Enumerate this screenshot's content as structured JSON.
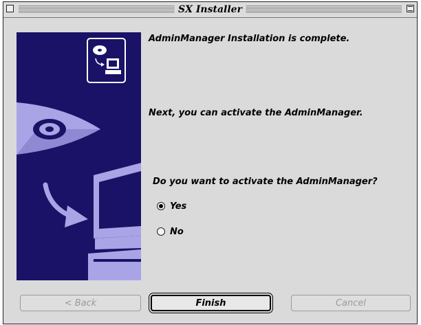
{
  "window": {
    "title": "SX Installer"
  },
  "content": {
    "complete_message": "AdminManager Installation is complete.",
    "next_message": "Next, you can activate the AdminManager.",
    "question": "Do you want to activate the AdminManager?",
    "options": [
      {
        "label": "Yes",
        "selected": true
      },
      {
        "label": "No",
        "selected": false
      }
    ]
  },
  "buttons": {
    "back": {
      "label": "< Back",
      "enabled": false
    },
    "finish": {
      "label": "Finish",
      "enabled": true,
      "default": true
    },
    "cancel": {
      "label": "Cancel",
      "enabled": false
    }
  },
  "colors": {
    "panel_background": "#1a1266",
    "illustration_lilac": "#a9a4e6",
    "window_background": "#dadada"
  },
  "icons": [
    "close-box-icon",
    "zoom-box-icon",
    "installer-icon",
    "cd-disc-icon",
    "computer-icon",
    "arrow-icon"
  ]
}
